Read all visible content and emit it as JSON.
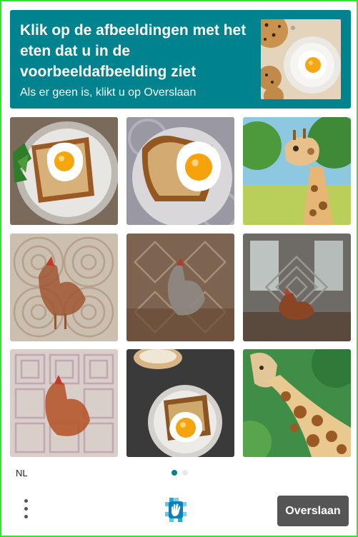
{
  "prompt": {
    "title": "Klik op de afbeeldingen met het eten dat u in de voorbeeldafbeelding ziet",
    "subtitle": "Als er geen is, klikt u op Overslaan"
  },
  "example_image": {
    "content": "cookies and fried egg on plate"
  },
  "tiles": [
    {
      "content": "fried egg on toast with greens"
    },
    {
      "content": "fried egg on toast"
    },
    {
      "content": "giraffe watercolor"
    },
    {
      "content": "chicken, distorted"
    },
    {
      "content": "chicken, distorted"
    },
    {
      "content": "chicken, distorted"
    },
    {
      "content": "chicken, distorted"
    },
    {
      "content": "fried egg on toast"
    },
    {
      "content": "giraffe watercolor"
    }
  ],
  "footer": {
    "language": "NL",
    "skip_label": "Overslaan",
    "page_count": 2,
    "active_page": 1
  },
  "colors": {
    "header_bg": "#00838f",
    "frame_border": "#2ee82e",
    "dot_active": "#00838f",
    "dot_inactive": "#e8e8e8",
    "skip_bg": "#555555"
  }
}
